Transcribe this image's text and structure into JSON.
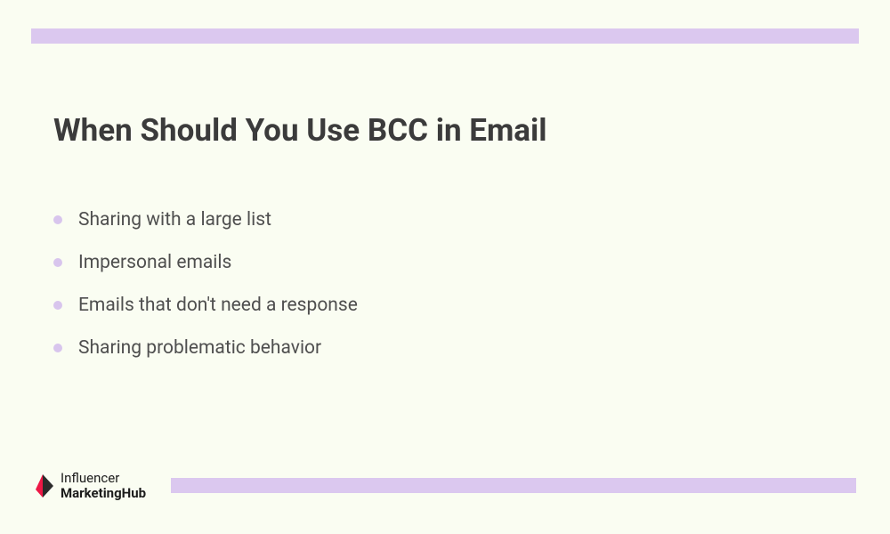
{
  "title": "When Should You Use BCC in Email",
  "items": [
    "Sharing with a large list",
    "Impersonal emails",
    "Emails that don't need a response",
    "Sharing problematic behavior"
  ],
  "logo": {
    "line1": "Influencer",
    "line2": "MarketingHub"
  },
  "colors": {
    "background": "#fafdf2",
    "accentBar": "#dbc8ef",
    "bullet": "#d8c5ed",
    "titleText": "#3b3b3b",
    "bodyText": "#4f4f4f",
    "logoRed": "#ed1846",
    "logoDark": "#2b2b2b"
  }
}
